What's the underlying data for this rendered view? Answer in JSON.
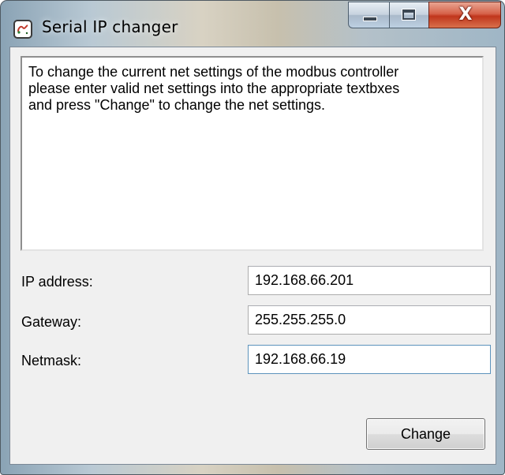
{
  "window": {
    "title": "Serial IP changer",
    "close_glyph": "X"
  },
  "info_text": "To change the current net settings of the modbus controller\nplease enter valid net settings into the appropriate textbxes\nand press \"Change\" to change the net settings.",
  "fields": {
    "ip_address": {
      "label": "IP address:",
      "value": "192.168.66.201"
    },
    "gateway": {
      "label": "Gateway:",
      "value": "255.255.255.0"
    },
    "netmask": {
      "label": "Netmask:",
      "value": "192.168.66.19"
    }
  },
  "buttons": {
    "change": "Change"
  },
  "icons": {
    "app": "serial-port-icon",
    "minimize": "minimize-icon",
    "maximize": "maximize-icon",
    "close": "close-icon"
  },
  "colors": {
    "close_button": "#c7391d",
    "focus_border": "#5c93bc",
    "client_background": "#f0f0f0"
  }
}
